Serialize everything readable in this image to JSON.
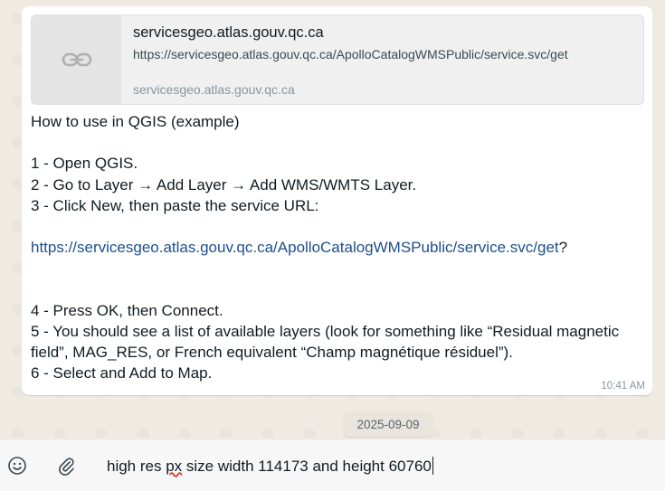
{
  "preview": {
    "title": "servicesgeo.atlas.gouv.qc.ca",
    "url": "https://servicesgeo.atlas.gouv.qc.ca/ApolloCatalogWMSPublic/service.svc/get",
    "domain": "servicesgeo.atlas.gouv.qc.ca",
    "icon": "link-icon"
  },
  "message": {
    "heading": "How to use in QGIS (example)",
    "step1": "1 - Open QGIS.",
    "step2": "2 - Go to Layer → Add Layer → Add WMS/WMTS Layer.",
    "step3": "3 - Click New, then paste the service URL:",
    "link": "https://servicesgeo.atlas.gouv.qc.ca/ApolloCatalogWMSPublic/service.svc/get",
    "link_suffix": "?",
    "step4": "4 - Press OK, then Connect.",
    "step5": "5 - You should see a list of available layers (look for something like “Residual magnetic field”, MAG_RES, or French equivalent “Champ magnétique résiduel”).",
    "step6": "6 - Select and Add to Map.",
    "time": "10:41 AM"
  },
  "date_chip": "2025-09-09",
  "composer": {
    "emoji_icon": "emoji-icon",
    "attach_icon": "paperclip-icon",
    "text_before": "high res ",
    "text_misspelled": "px",
    "text_after": " size width 114173 and height 60760"
  }
}
